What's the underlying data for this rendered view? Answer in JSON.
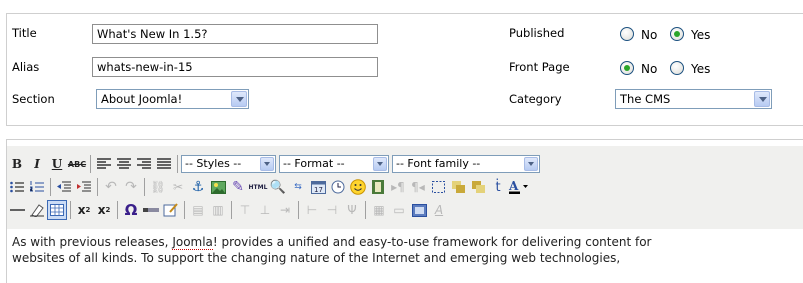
{
  "details": {
    "title": {
      "label": "Title",
      "value": "What's New In 1.5?"
    },
    "alias": {
      "label": "Alias",
      "value": "whats-new-in-15"
    },
    "section": {
      "label": "Section",
      "value": "About Joomla!"
    },
    "published": {
      "label": "Published",
      "options": [
        "No",
        "Yes"
      ],
      "selected": "Yes"
    },
    "frontpage": {
      "label": "Front Page",
      "options": [
        "No",
        "Yes"
      ],
      "selected": "No"
    },
    "category": {
      "label": "Category",
      "value": "The CMS"
    }
  },
  "toolbar": {
    "styles": "-- Styles --",
    "format": "-- Format --",
    "font_family": "-- Font family --",
    "bold": "B",
    "italic": "I",
    "underline": "U",
    "strike": "ABC",
    "subscript": "x",
    "superscript": "x",
    "omega": "Ω"
  },
  "content": {
    "line1": "As with previous releases, ",
    "line1_word": "Joomla",
    "line1_rest": "! provides a unified and easy-to-use framework for delivering content for",
    "line2": "websites of all kinds. To support the changing nature of the Internet and emerging web technologies,"
  }
}
